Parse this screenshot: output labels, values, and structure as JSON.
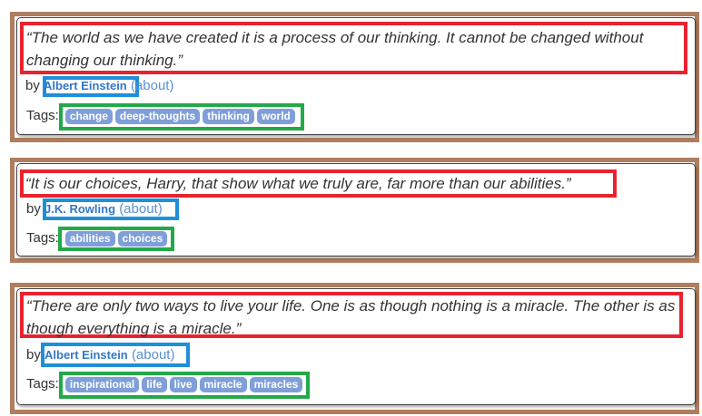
{
  "quotes": [
    {
      "text": "“The world as we have created it is a process of our thinking. It cannot be changed without changing our thinking.”",
      "by_label": "by",
      "author": "Albert Einstein",
      "about": "(about)",
      "tags_label": "Tags:",
      "tags": [
        "change",
        "deep-thoughts",
        "thinking",
        "world"
      ]
    },
    {
      "text": "“It is our choices, Harry, that show what we truly are, far more than our abilities.”",
      "by_label": "by",
      "author": "J.K. Rowling",
      "about": "(about)",
      "tags_label": "Tags:",
      "tags": [
        "abilities",
        "choices"
      ]
    },
    {
      "text": "“There are only two ways to live your life. One is as though nothing is a miracle. The other is as though everything is a miracle.”",
      "by_label": "by",
      "author": "Albert Einstein",
      "about": "(about)",
      "tags_label": "Tags:",
      "tags": [
        "inspirational",
        "life",
        "live",
        "miracle",
        "miracles"
      ]
    }
  ],
  "colors": {
    "outer_frame": "#b07d5e",
    "quote_highlight": "#e8232e",
    "author_highlight": "#1e8fd9",
    "tags_highlight": "#22a948",
    "tag_background": "#7e9fd9",
    "author_link": "#3277c9"
  }
}
